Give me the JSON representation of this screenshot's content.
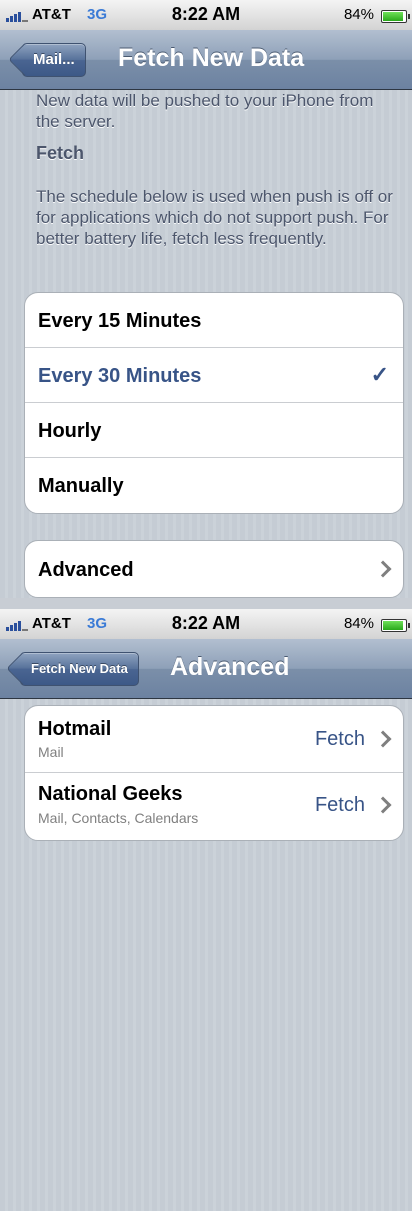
{
  "screen1": {
    "status": {
      "carrier": "AT&T",
      "network": "3G",
      "time": "8:22 AM",
      "battery": "84%",
      "battery_level": 0.84
    },
    "nav": {
      "back": "Mail...",
      "title": "Fetch New Data"
    },
    "push_text": "New data will be pushed to your iPhone from the server.",
    "fetch_title": "Fetch",
    "fetch_desc": "The schedule below is used when push is off or for applications which do not support push. For better battery life, fetch less frequently.",
    "options": [
      {
        "label": "Every 15 Minutes",
        "selected": false
      },
      {
        "label": "Every 30 Minutes",
        "selected": true,
        "check": "✓"
      },
      {
        "label": "Hourly",
        "selected": false
      },
      {
        "label": "Manually",
        "selected": false
      }
    ],
    "advanced": "Advanced"
  },
  "screen2": {
    "status": {
      "carrier": "AT&T",
      "network": "3G",
      "time": "8:22 AM",
      "battery": "84%",
      "battery_level": 0.84
    },
    "nav": {
      "back": "Fetch New Data",
      "title": "Advanced"
    },
    "accounts": [
      {
        "name": "Hotmail",
        "detail": "Mail",
        "value": "Fetch"
      },
      {
        "name": "National Geeks",
        "detail": "Mail, Contacts, Calendars",
        "value": "Fetch"
      }
    ]
  },
  "colors": {
    "accent": "#385487",
    "nav": "#6c82a1"
  },
  "icons": {
    "check": "checkmark-icon",
    "chevron": "chevron-right-icon"
  }
}
